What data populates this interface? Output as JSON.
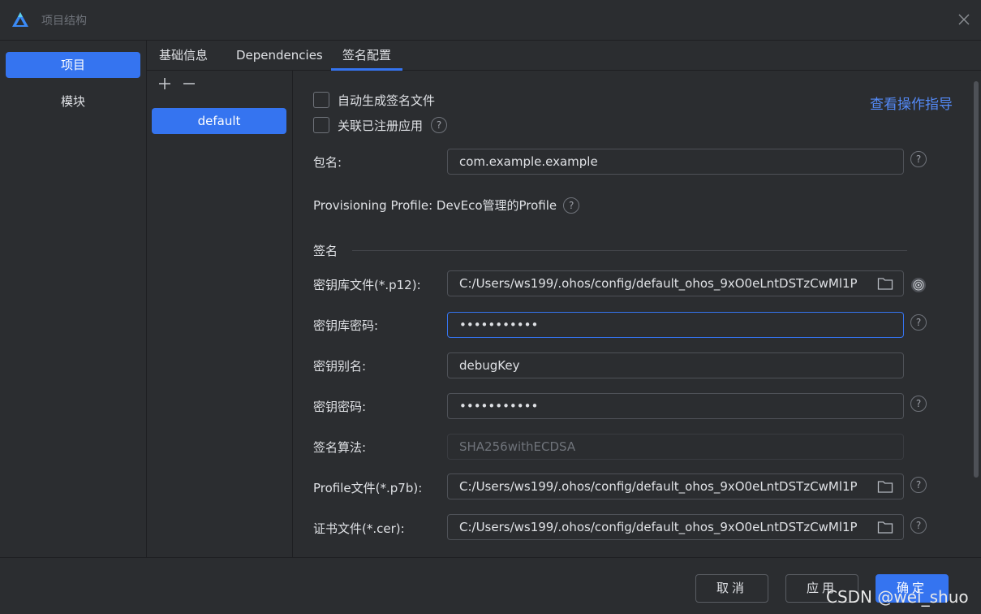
{
  "window": {
    "title": "项目结构",
    "logo_icon": "deveco-logo-icon",
    "close_icon": "close-icon"
  },
  "sidebar": {
    "items": [
      {
        "label": "项目",
        "active": true
      },
      {
        "label": "模块",
        "active": false
      }
    ]
  },
  "tabs": [
    {
      "label": "基础信息",
      "active": false
    },
    {
      "label": "Dependencies",
      "active": false
    },
    {
      "label": "签名配置",
      "active": true
    }
  ],
  "configs": {
    "add_icon": "plus-icon",
    "remove_icon": "minus-icon",
    "items": [
      {
        "label": "default",
        "selected": true
      }
    ]
  },
  "signing": {
    "auto_generate": {
      "label": "自动生成签名文件",
      "checked": false
    },
    "link_registered": {
      "label": "关联已注册应用",
      "checked": false
    },
    "guide_link": "查看操作指导",
    "bundle_name": {
      "label": "包名:",
      "value": "com.example.example"
    },
    "provisioning": "Provisioning Profile: DevEco管理的Profile",
    "section_title": "签名",
    "store_file": {
      "label": "密钥库文件(*.p12):",
      "value": "C:/Users/ws199/.ohos/config/default_ohos_9xO0eLntDSTzCwMl1P"
    },
    "store_password": {
      "label": "密钥库密码:",
      "value": "•••••••••••"
    },
    "key_alias": {
      "label": "密钥别名:",
      "value": "debugKey"
    },
    "key_password": {
      "label": "密钥密码:",
      "value": "•••••••••••"
    },
    "sign_alg": {
      "label": "签名算法:",
      "value": "SHA256withECDSA"
    },
    "profile_file": {
      "label": "Profile文件(*.p7b):",
      "value": "C:/Users/ws199/.ohos/config/default_ohos_9xO0eLntDSTzCwMl1P"
    },
    "cert_file": {
      "label": "证书文件(*.cer):",
      "value": "C:/Users/ws199/.ohos/config/default_ohos_9xO0eLntDSTzCwMl1P"
    },
    "help_glyph": "?"
  },
  "footer": {
    "cancel": "取消",
    "apply": "应用",
    "ok": "确定",
    "watermark": "CSDN @wei_shuo"
  },
  "colors": {
    "accent": "#3574f0",
    "link": "#548af7",
    "background": "#2b2d30",
    "border": "#1e1f22"
  }
}
